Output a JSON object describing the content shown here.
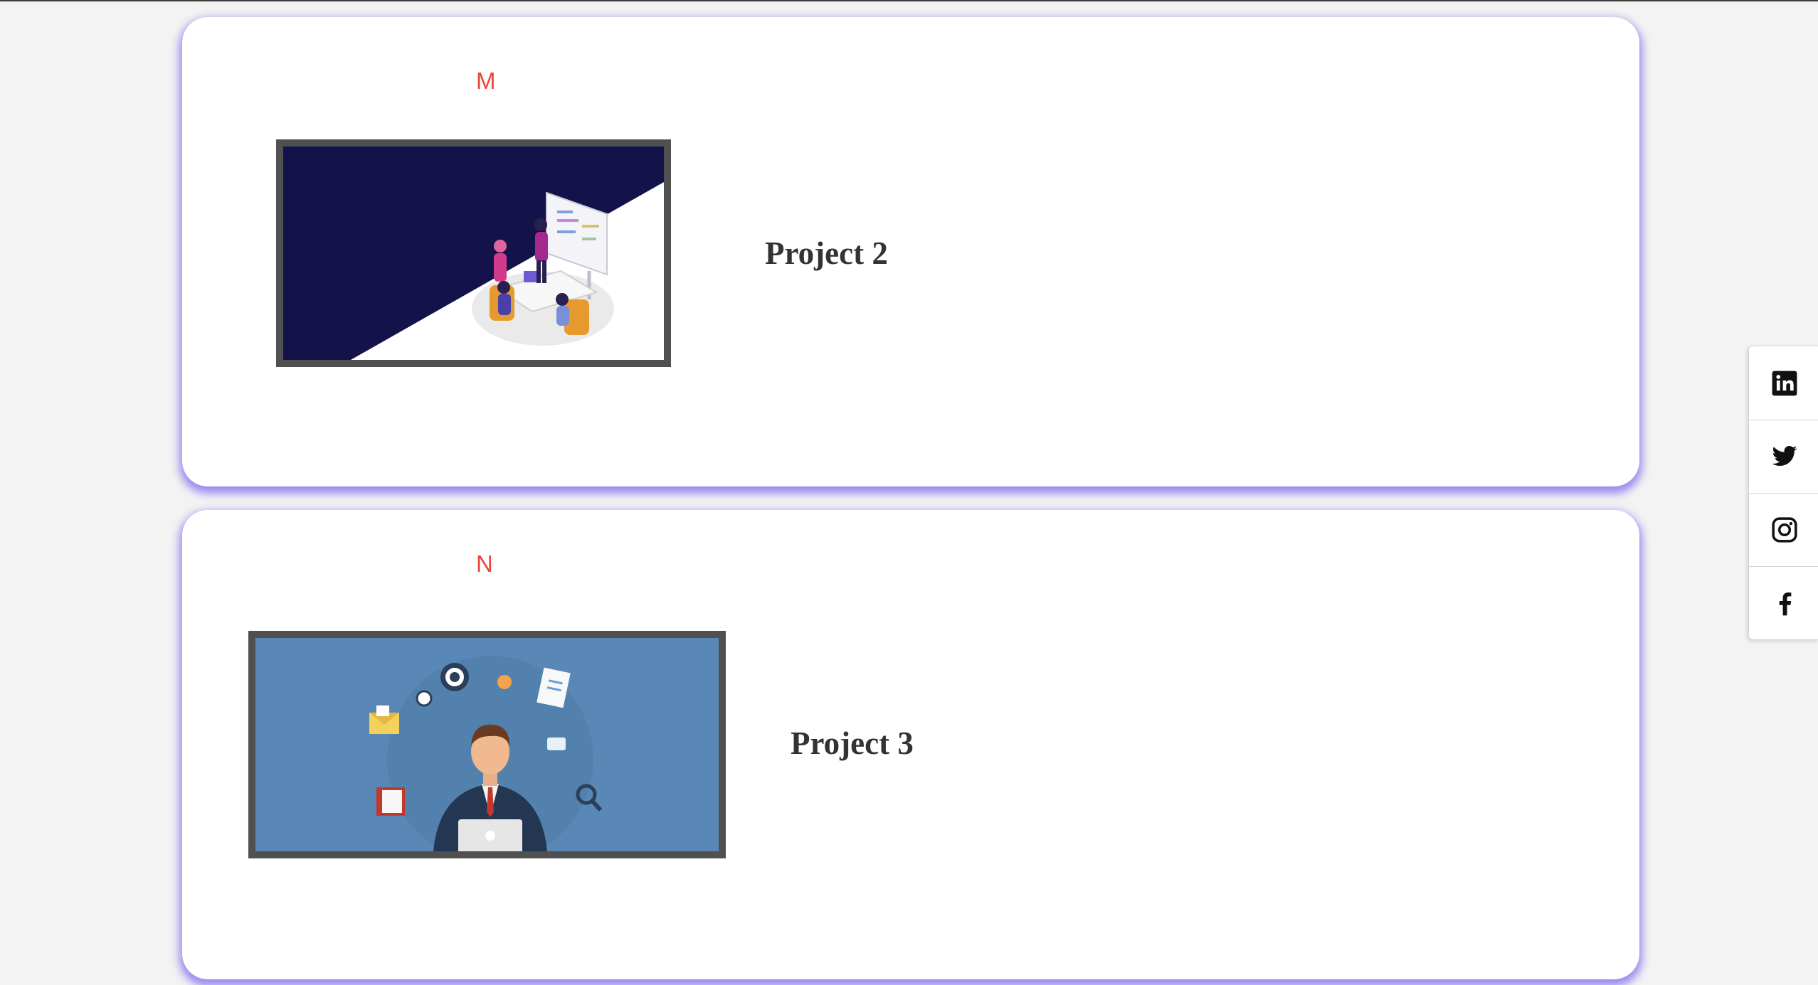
{
  "colors": {
    "page_background": "#f3f3f3",
    "card_background": "#ffffff",
    "card_glow": "#7b68ee",
    "letter_accent": "#e8453c",
    "title_text": "#333333",
    "frame_border": "#505050"
  },
  "projects": [
    {
      "letter": "M",
      "title": "Project 2",
      "image_icon": "team-meeting-illustration-icon"
    },
    {
      "letter": "N",
      "title": "Project 3",
      "image_icon": "business-man-with-laptop-illustration-icon"
    }
  ],
  "social_sidebar": {
    "items": [
      {
        "icon": "linkedin-icon"
      },
      {
        "icon": "twitter-icon"
      },
      {
        "icon": "instagram-icon"
      },
      {
        "icon": "facebook-icon"
      }
    ]
  }
}
